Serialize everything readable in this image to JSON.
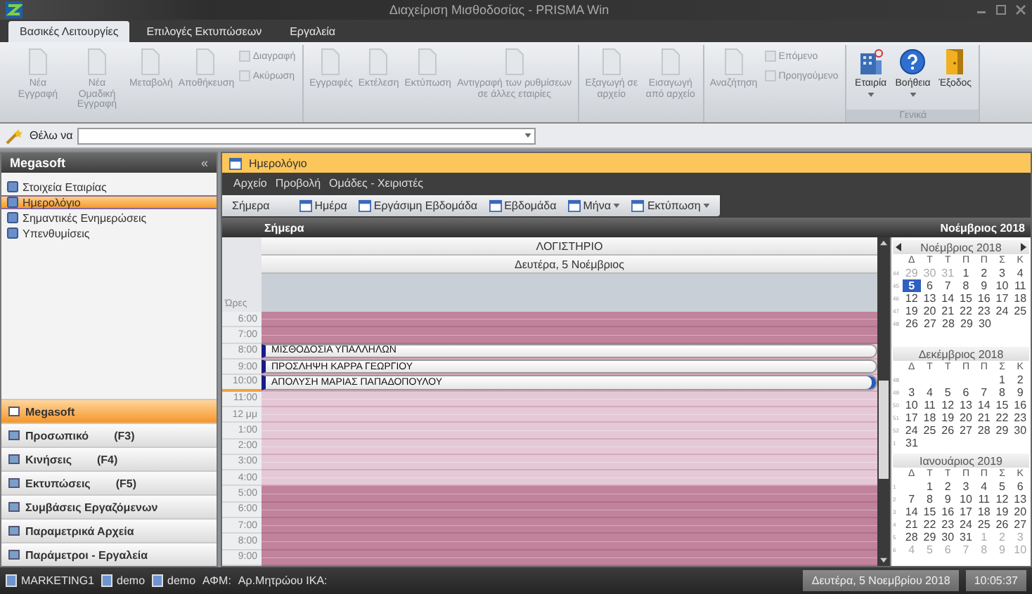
{
  "window": {
    "title": "Διαχείριση Μισθοδοσίας - PRISMA Win"
  },
  "ribbon": {
    "tabs": [
      {
        "label": "Βασικές Λειτουργίες",
        "selected": true
      },
      {
        "label": "Επιλογές Εκτυπώσεων",
        "selected": false
      },
      {
        "label": "Εργαλεία",
        "selected": false
      }
    ],
    "groups": [
      {
        "buttons": [
          {
            "kind": "large",
            "label": "Νέα Εγγραφή",
            "disabled": true,
            "dropdown": false
          },
          {
            "kind": "large",
            "label": "Νέα Ομαδική Εγγραφή",
            "disabled": true,
            "dropdown": false
          },
          {
            "kind": "large",
            "label": "Μεταβολή",
            "disabled": true,
            "dropdown": false
          },
          {
            "kind": "large",
            "label": "Αποθήκευση",
            "disabled": true,
            "dropdown": false
          },
          {
            "kind": "small",
            "label": "Διαγραφή",
            "disabled": true
          },
          {
            "kind": "small",
            "label": "Ακύρωση",
            "disabled": true
          }
        ]
      },
      {
        "buttons": [
          {
            "kind": "large",
            "label": "Εγγραφές",
            "disabled": true,
            "dropdown": false
          },
          {
            "kind": "large",
            "label": "Εκτέλεση",
            "disabled": true,
            "dropdown": false
          },
          {
            "kind": "large",
            "label": "Εκτύπωση",
            "disabled": true,
            "dropdown": false
          },
          {
            "kind": "large",
            "label": "Αντιγραφή των ρυθμίσεων σε άλλες εταιρίες",
            "disabled": true,
            "dropdown": false
          }
        ]
      },
      {
        "buttons": [
          {
            "kind": "large",
            "label": "Εξαγωγή σε αρχείο",
            "disabled": true,
            "dropdown": false
          },
          {
            "kind": "large",
            "label": "Εισαγωγή από αρχείο",
            "disabled": true,
            "dropdown": false
          }
        ]
      },
      {
        "buttons": [
          {
            "kind": "large",
            "label": "Αναζήτηση",
            "disabled": true,
            "dropdown": false
          },
          {
            "kind": "small",
            "label": "Επόμενο",
            "disabled": true
          },
          {
            "kind": "small",
            "label": "Προηγούμενο",
            "disabled": true
          }
        ]
      },
      {
        "label": "Γενικά",
        "buttons": [
          {
            "kind": "large",
            "label": "Εταιρία",
            "disabled": false,
            "dropdown": true
          },
          {
            "kind": "large",
            "label": "Βοήθεια",
            "disabled": false,
            "dropdown": true
          },
          {
            "kind": "large",
            "label": "Έξοδος",
            "disabled": false,
            "dropdown": false
          }
        ]
      }
    ]
  },
  "want": {
    "label": "Θέλω να"
  },
  "sidebar": {
    "title": "Megasoft",
    "collapse": "«",
    "items": [
      {
        "label": "Στοιχεία Εταιρίας",
        "selected": false
      },
      {
        "label": "Ημερολόγιο",
        "selected": true
      },
      {
        "label": "Σημαντικές Ενημερώσεις",
        "selected": false
      },
      {
        "label": "Υπενθυμίσεις",
        "selected": false
      }
    ],
    "nav": [
      {
        "label": "Megasoft",
        "selected": true
      },
      {
        "label": "Προσωπικό",
        "shortcut": "(F3)",
        "selected": false
      },
      {
        "label": "Κινήσεις",
        "shortcut": "(F4)",
        "selected": false
      },
      {
        "label": "Εκτυπώσεις",
        "shortcut": "(F5)",
        "selected": false
      },
      {
        "label": "Συμβάσεις Εργαζόμενων",
        "selected": false
      },
      {
        "label": "Παραμετρικά Αρχεία",
        "selected": false
      },
      {
        "label": "Παράμετροι - Εργαλεία",
        "selected": false
      }
    ]
  },
  "panel": {
    "title": "Ημερολόγιο",
    "menu": [
      "Αρχείο",
      "Προβολή",
      "Ομάδες - Χειριστές"
    ],
    "toolbar": [
      {
        "label": "Σήμερα",
        "icon": false,
        "dropdown": false
      },
      {
        "label": "Ημέρα",
        "icon": true,
        "dropdown": false
      },
      {
        "label": "Εργάσιμη Εβδομάδα",
        "icon": true,
        "dropdown": false
      },
      {
        "label": "Εβδομάδα",
        "icon": true,
        "dropdown": false
      },
      {
        "label": "Μήνα",
        "icon": true,
        "dropdown": true
      },
      {
        "label": "Εκτύπωση",
        "icon": true,
        "dropdown": true
      }
    ],
    "header_left": "Σήμερα",
    "header_right": "Νοέμβριος 2018",
    "day": {
      "resource": "ΛΟΓΙΣΤΗΡΙΟ",
      "date": "Δευτέρα, 5 Νοέμβριος",
      "hours_label": "Ώρες",
      "rows": [
        {
          "time": "6:00",
          "kind": "off",
          "current": false
        },
        {
          "time": "7:00",
          "kind": "off",
          "current": false
        },
        {
          "time": "8:00",
          "kind": "work",
          "current": false,
          "appointment": {
            "text": "ΜΙΣΘΟΔΟΣΙΑ ΥΠΑΛΛΗΛΩΝ",
            "selected": false
          }
        },
        {
          "time": "9:00",
          "kind": "work",
          "current": false,
          "appointment": {
            "text": "ΠΡΟΣΛΗΨΗ ΚΑΡΡΑ ΓΕΩΡΓΙΟΥ",
            "selected": false
          }
        },
        {
          "time": "10:00",
          "kind": "work",
          "current": true,
          "appointment": {
            "text": "ΑΠΟΛΥΣΗ ΜΑΡΙΑΣ ΠΑΠΑΔΟΠΟΥΛΟΥ",
            "selected": true
          }
        },
        {
          "time": "11:00",
          "kind": "work",
          "current": false
        },
        {
          "time": "12 μμ",
          "kind": "work",
          "current": false
        },
        {
          "time": "1:00",
          "kind": "work",
          "current": false
        },
        {
          "time": "2:00",
          "kind": "work",
          "current": false
        },
        {
          "time": "3:00",
          "kind": "work",
          "current": false
        },
        {
          "time": "4:00",
          "kind": "work",
          "current": false
        },
        {
          "time": "5:00",
          "kind": "off",
          "current": false
        },
        {
          "time": "6:00",
          "kind": "off",
          "current": false
        },
        {
          "time": "7:00",
          "kind": "off",
          "current": false
        },
        {
          "time": "8:00",
          "kind": "off",
          "current": false
        },
        {
          "time": "9:00",
          "kind": "off",
          "current": false
        }
      ]
    },
    "calendars": [
      {
        "title": "Νοέμβριος 2018",
        "arrows": true,
        "weekdays": [
          "Δ",
          "Τ",
          "Τ",
          "Π",
          "Π",
          "Σ",
          "Κ"
        ],
        "weeks": [
          {
            "number": "44",
            "days": [
              {
                "label": "29",
                "kind": "other",
                "selected": false
              },
              {
                "label": "30",
                "kind": "other",
                "selected": false
              },
              {
                "label": "31",
                "kind": "other",
                "selected": false
              },
              {
                "label": "1",
                "kind": "day",
                "selected": false
              },
              {
                "label": "2",
                "kind": "day",
                "selected": false
              },
              {
                "label": "3",
                "kind": "day",
                "selected": false
              },
              {
                "label": "4",
                "kind": "day",
                "selected": false
              }
            ]
          },
          {
            "number": "45",
            "days": [
              {
                "label": "5",
                "kind": "day",
                "selected": true
              },
              {
                "label": "6",
                "kind": "day",
                "selected": false
              },
              {
                "label": "7",
                "kind": "day",
                "selected": false
              },
              {
                "label": "8",
                "kind": "day",
                "selected": false
              },
              {
                "label": "9",
                "kind": "day",
                "selected": false
              },
              {
                "label": "10",
                "kind": "day",
                "selected": false
              },
              {
                "label": "11",
                "kind": "day",
                "selected": false
              }
            ]
          },
          {
            "number": "46",
            "days": [
              {
                "label": "12",
                "kind": "day",
                "selected": false
              },
              {
                "label": "13",
                "kind": "day",
                "selected": false
              },
              {
                "label": "14",
                "kind": "day",
                "selected": false
              },
              {
                "label": "15",
                "kind": "day",
                "selected": false
              },
              {
                "label": "16",
                "kind": "day",
                "selected": false
              },
              {
                "label": "17",
                "kind": "day",
                "selected": false
              },
              {
                "label": "18",
                "kind": "day",
                "selected": false
              }
            ]
          },
          {
            "number": "47",
            "days": [
              {
                "label": "19",
                "kind": "day",
                "selected": false
              },
              {
                "label": "20",
                "kind": "day",
                "selected": false
              },
              {
                "label": "21",
                "kind": "day",
                "selected": false
              },
              {
                "label": "22",
                "kind": "day",
                "selected": false
              },
              {
                "label": "23",
                "kind": "day",
                "selected": false
              },
              {
                "label": "24",
                "kind": "day",
                "selected": false
              },
              {
                "label": "25",
                "kind": "day",
                "selected": false
              }
            ]
          },
          {
            "number": "48",
            "days": [
              {
                "label": "26",
                "kind": "day",
                "selected": false
              },
              {
                "label": "27",
                "kind": "day",
                "selected": false
              },
              {
                "label": "28",
                "kind": "day",
                "selected": false
              },
              {
                "label": "29",
                "kind": "day",
                "selected": false
              },
              {
                "label": "30",
                "kind": "day",
                "selected": false
              }
            ]
          }
        ]
      },
      {
        "title": "Δεκέμβριος 2018",
        "arrows": false,
        "weekdays": [
          "Δ",
          "Τ",
          "Τ",
          "Π",
          "Π",
          "Σ",
          "Κ"
        ],
        "weeks": [
          {
            "number": "48",
            "days": [
              {
                "kind": "blank"
              },
              {
                "kind": "blank"
              },
              {
                "kind": "blank"
              },
              {
                "kind": "blank"
              },
              {
                "kind": "blank"
              },
              {
                "label": "1",
                "kind": "day",
                "selected": false
              },
              {
                "label": "2",
                "kind": "day",
                "selected": false
              }
            ]
          },
          {
            "number": "49",
            "days": [
              {
                "label": "3",
                "kind": "day",
                "selected": false
              },
              {
                "label": "4",
                "kind": "day",
                "selected": false
              },
              {
                "label": "5",
                "kind": "day",
                "selected": false
              },
              {
                "label": "6",
                "kind": "day",
                "selected": false
              },
              {
                "label": "7",
                "kind": "day",
                "selected": false
              },
              {
                "label": "8",
                "kind": "day",
                "selected": false
              },
              {
                "label": "9",
                "kind": "day",
                "selected": false
              }
            ]
          },
          {
            "number": "50",
            "days": [
              {
                "label": "10",
                "kind": "day",
                "selected": false
              },
              {
                "label": "11",
                "kind": "day",
                "selected": false
              },
              {
                "label": "12",
                "kind": "day",
                "selected": false
              },
              {
                "label": "13",
                "kind": "day",
                "selected": false
              },
              {
                "label": "14",
                "kind": "day",
                "selected": false
              },
              {
                "label": "15",
                "kind": "day",
                "selected": false
              },
              {
                "label": "16",
                "kind": "day",
                "selected": false
              }
            ]
          },
          {
            "number": "51",
            "days": [
              {
                "label": "17",
                "kind": "day",
                "selected": false
              },
              {
                "label": "18",
                "kind": "day",
                "selected": false
              },
              {
                "label": "19",
                "kind": "day",
                "selected": false
              },
              {
                "label": "20",
                "kind": "day",
                "selected": false
              },
              {
                "label": "21",
                "kind": "day",
                "selected": false
              },
              {
                "label": "22",
                "kind": "day",
                "selected": false
              },
              {
                "label": "23",
                "kind": "day",
                "selected": false
              }
            ]
          },
          {
            "number": "52",
            "days": [
              {
                "label": "24",
                "kind": "day",
                "selected": false
              },
              {
                "label": "25",
                "kind": "day",
                "selected": false
              },
              {
                "label": "26",
                "kind": "day",
                "selected": false
              },
              {
                "label": "27",
                "kind": "day",
                "selected": false
              },
              {
                "label": "28",
                "kind": "day",
                "selected": false
              },
              {
                "label": "29",
                "kind": "day",
                "selected": false
              },
              {
                "label": "30",
                "kind": "day",
                "selected": false
              }
            ]
          },
          {
            "number": "1",
            "days": [
              {
                "label": "31",
                "kind": "day",
                "selected": false
              }
            ]
          }
        ]
      },
      {
        "title": "Ιανουάριος 2019",
        "arrows": false,
        "weekdays": [
          "Δ",
          "Τ",
          "Τ",
          "Π",
          "Π",
          "Σ",
          "Κ"
        ],
        "weeks": [
          {
            "number": "1",
            "days": [
              {
                "kind": "blank"
              },
              {
                "label": "1",
                "kind": "day",
                "selected": false
              },
              {
                "label": "2",
                "kind": "day",
                "selected": false
              },
              {
                "label": "3",
                "kind": "day",
                "selected": false
              },
              {
                "label": "4",
                "kind": "day",
                "selected": false
              },
              {
                "label": "5",
                "kind": "day",
                "selected": false
              },
              {
                "label": "6",
                "kind": "day",
                "selected": false
              }
            ]
          },
          {
            "number": "2",
            "days": [
              {
                "label": "7",
                "kind": "day",
                "selected": false
              },
              {
                "label": "8",
                "kind": "day",
                "selected": false
              },
              {
                "label": "9",
                "kind": "day",
                "selected": false
              },
              {
                "label": "10",
                "kind": "day",
                "selected": false
              },
              {
                "label": "11",
                "kind": "day",
                "selected": false
              },
              {
                "label": "12",
                "kind": "day",
                "selected": false
              },
              {
                "label": "13",
                "kind": "day",
                "selected": false
              }
            ]
          },
          {
            "number": "3",
            "days": [
              {
                "label": "14",
                "kind": "day",
                "selected": false
              },
              {
                "label": "15",
                "kind": "day",
                "selected": false
              },
              {
                "label": "16",
                "kind": "day",
                "selected": false
              },
              {
                "label": "17",
                "kind": "day",
                "selected": false
              },
              {
                "label": "18",
                "kind": "day",
                "selected": false
              },
              {
                "label": "19",
                "kind": "day",
                "selected": false
              },
              {
                "label": "20",
                "kind": "day",
                "selected": false
              }
            ]
          },
          {
            "number": "4",
            "days": [
              {
                "label": "21",
                "kind": "day",
                "selected": false
              },
              {
                "label": "22",
                "kind": "day",
                "selected": false
              },
              {
                "label": "23",
                "kind": "day",
                "selected": false
              },
              {
                "label": "24",
                "kind": "day",
                "selected": false
              },
              {
                "label": "25",
                "kind": "day",
                "selected": false
              },
              {
                "label": "26",
                "kind": "day",
                "selected": false
              },
              {
                "label": "27",
                "kind": "day",
                "selected": false
              }
            ]
          },
          {
            "number": "5",
            "days": [
              {
                "label": "28",
                "kind": "day",
                "selected": false
              },
              {
                "label": "29",
                "kind": "day",
                "selected": false
              },
              {
                "label": "30",
                "kind": "day",
                "selected": false
              },
              {
                "label": "31",
                "kind": "day",
                "selected": false
              },
              {
                "label": "1",
                "kind": "other",
                "selected": false
              },
              {
                "label": "2",
                "kind": "other",
                "selected": false
              },
              {
                "label": "3",
                "kind": "other",
                "selected": false
              }
            ]
          },
          {
            "number": "6",
            "days": [
              {
                "label": "4",
                "kind": "other",
                "selected": false
              },
              {
                "label": "5",
                "kind": "other",
                "selected": false
              },
              {
                "label": "6",
                "kind": "other",
                "selected": false
              },
              {
                "label": "7",
                "kind": "other",
                "selected": false
              },
              {
                "label": "8",
                "kind": "other",
                "selected": false
              },
              {
                "label": "9",
                "kind": "other",
                "selected": false
              },
              {
                "label": "10",
                "kind": "other",
                "selected": false
              }
            ]
          }
        ]
      }
    ]
  },
  "status_bar": {
    "left": [
      {
        "text": "MARKETING1",
        "icon": true
      },
      {
        "text": "demo",
        "icon": true
      },
      {
        "text": "demo",
        "icon": true
      },
      {
        "text": "ΑΦΜ:",
        "icon": false
      },
      {
        "text": "Αρ.Μητρώου ΙΚΑ:",
        "icon": false
      }
    ],
    "date": "Δευτέρα, 5 Νοεμβρίου 2018",
    "time": "10:05:37"
  }
}
